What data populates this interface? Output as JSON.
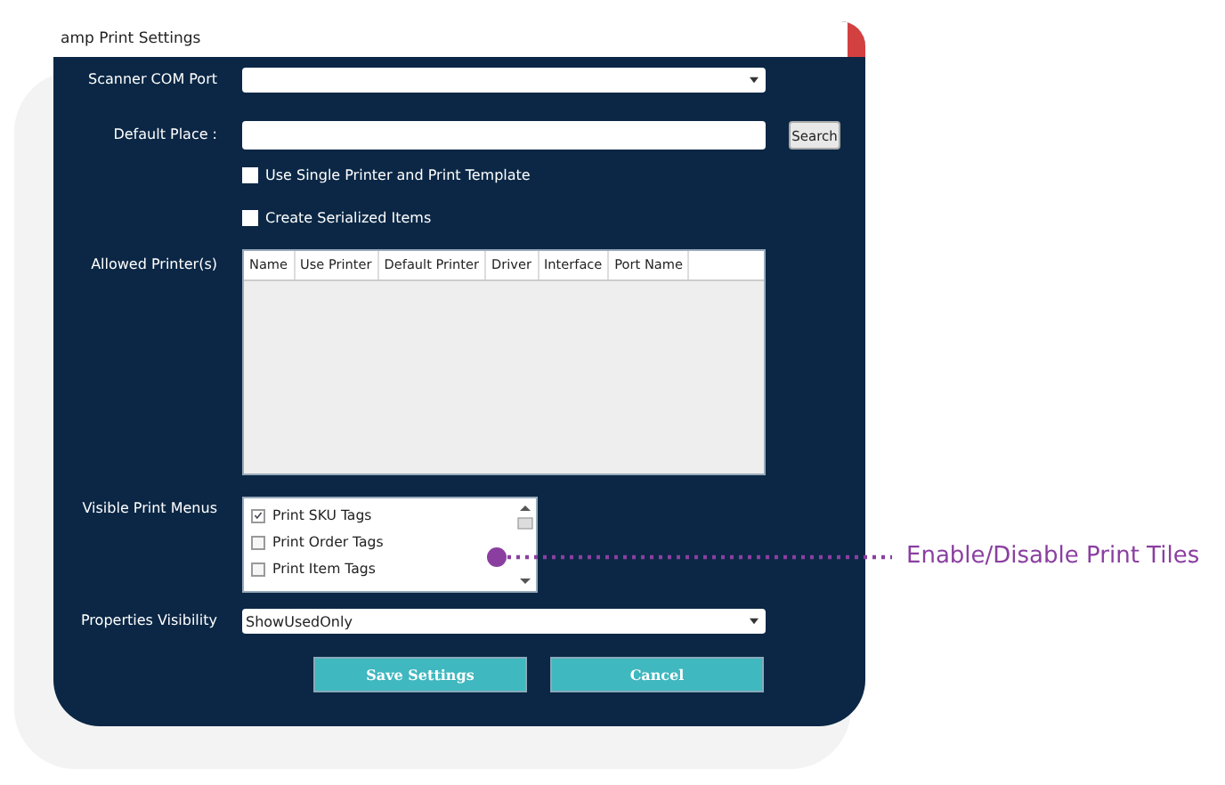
{
  "window": {
    "title": "amp Print Settings"
  },
  "scanner_com_port": {
    "label": "Scanner COM Port"
  },
  "default_place": {
    "label": "Default Place :",
    "search_button": "Search"
  },
  "options": [
    {
      "label": "Use Single Printer and Print Template",
      "checked": false
    },
    {
      "label": "Create Serialized Items",
      "checked": false
    }
  ],
  "allowed_printers": {
    "label": "Allowed Printer(s)",
    "columns": [
      "Name",
      "Use Printer",
      "Default Printer",
      "Driver",
      "Interface",
      "Port Name"
    ]
  },
  "visible_print_menus": {
    "label": "Visible Print Menus",
    "items": [
      {
        "label": "Print SKU Tags",
        "checked": true
      },
      {
        "label": "Print Order Tags",
        "checked": false
      },
      {
        "label": "Print Item Tags",
        "checked": false
      }
    ]
  },
  "properties_visibility": {
    "label": "Properties Visibility",
    "value": "ShowUsedOnly"
  },
  "buttons": [
    "Save Settings",
    "Cancel"
  ],
  "annotation": "Enable/Disable Print Tiles"
}
